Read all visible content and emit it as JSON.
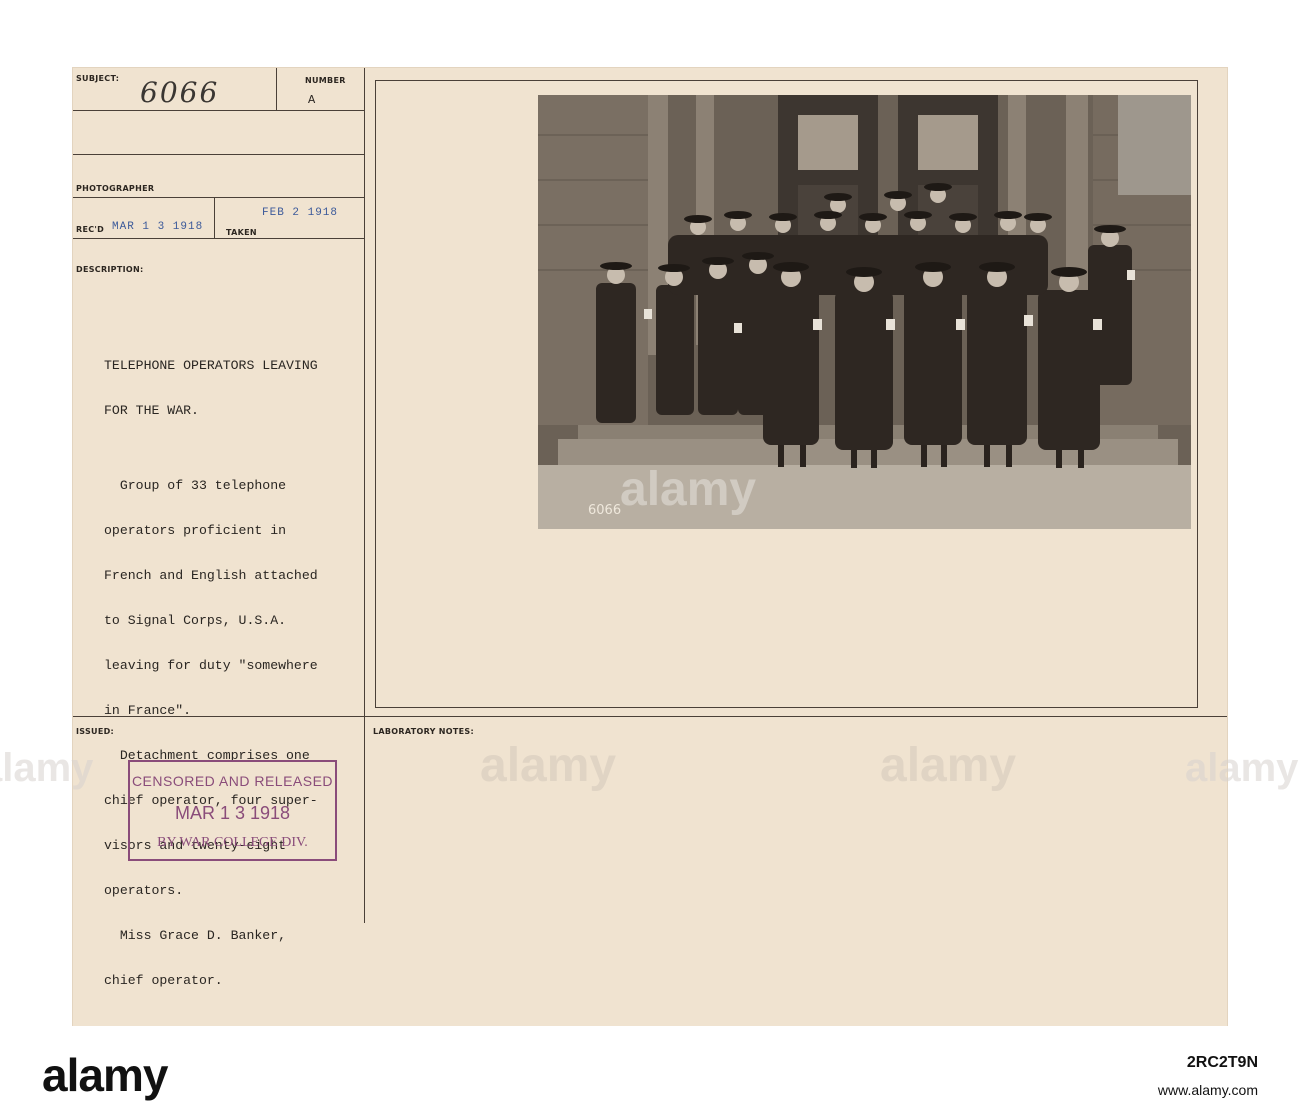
{
  "card": {
    "labels": {
      "subject": "SUBJECT:",
      "number": "NUMBER",
      "photographer": "PHOTOGRAPHER",
      "recd": "REC'D",
      "taken": "TAKEN",
      "description": "DESCRIPTION:",
      "issued": "ISSUED:",
      "lab_notes": "LABORATORY NOTES:"
    },
    "subject_value": "6066",
    "number_value": "A",
    "recd_date": "MAR 1 3 1918",
    "taken_date": "FEB 2   1918",
    "description_lines": [
      "TELEPHONE OPERATORS LEAVING",
      "FOR THE WAR.",
      "",
      "  Group of 33 telephone",
      "operators proficient in",
      "French and English attached",
      "to Signal Corps, U.S.A.",
      "leaving for duty \"somewhere",
      "in France\".",
      "  Detachment comprises one",
      "chief operator, four super-",
      "visors and twenty-eight",
      "operators.",
      "  Miss Grace D. Banker,",
      "chief operator."
    ]
  },
  "photo": {
    "negative_number": "6066"
  },
  "stamp": {
    "line1": "CENSORED AND RELEASED",
    "line2": "MAR 1 3 1918",
    "line3": "BY WAR COLLEGE DIV."
  },
  "watermark": {
    "brand": "alamy"
  },
  "footer": {
    "image_id": "2RC2T9N",
    "site": "www.alamy.com"
  }
}
